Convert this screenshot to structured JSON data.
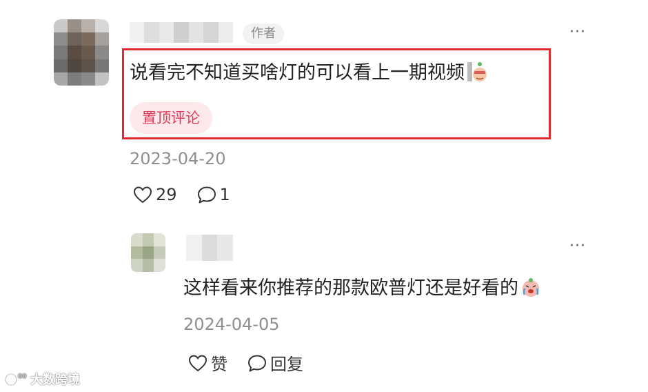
{
  "comment": {
    "author_badge": "作者",
    "text": "说看完不知道买啥灯的可以看上一期视频",
    "pinned_label": "置顶评论",
    "date": "2023-04-20",
    "likes": "29",
    "replies": "1",
    "more": "···"
  },
  "reply": {
    "text": "这样看来你推荐的那款欧普灯还是好看的",
    "date": "2024-04-05",
    "like_label": "赞",
    "reply_label": "回复",
    "more": "···"
  },
  "watermark": {
    "text": "大数跨境"
  },
  "colors": {
    "highlight": "#e0292e",
    "pinned_bg": "#fde9ec",
    "pinned_text": "#e33a5a",
    "muted": "#8f8f8f"
  }
}
